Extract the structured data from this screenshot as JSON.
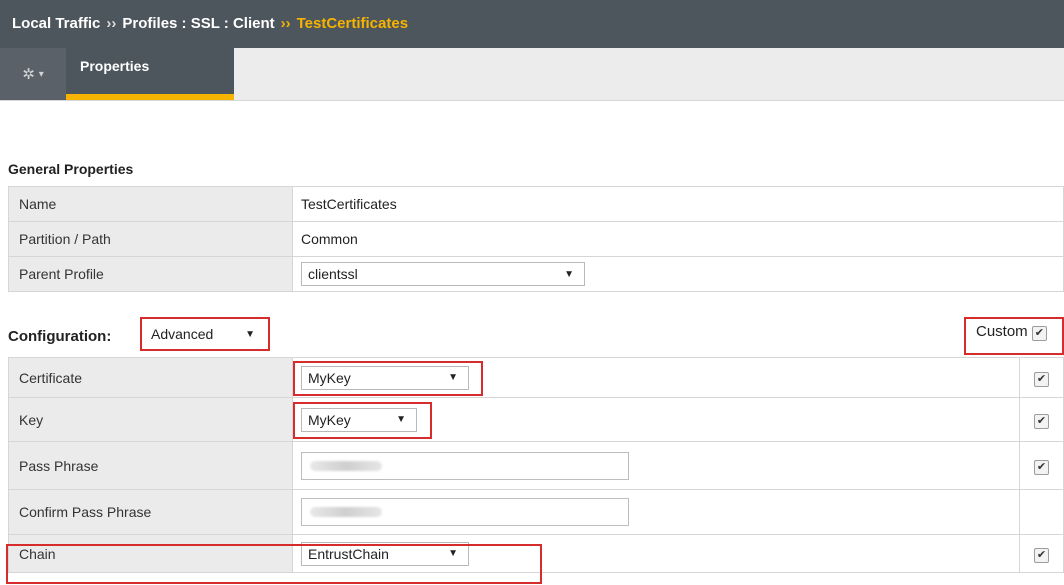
{
  "breadcrumb": {
    "part1": "Local Traffic",
    "sep1": "››",
    "part2": "Profiles : SSL : Client",
    "sep2": "››",
    "current": "TestCertificates"
  },
  "tabs": {
    "gear_icon": "gear-icon",
    "properties_label": "Properties"
  },
  "general": {
    "section_title": "General Properties",
    "rows": {
      "name": {
        "label": "Name",
        "value": "TestCertificates"
      },
      "partition": {
        "label": "Partition / Path",
        "value": "Common"
      },
      "parent": {
        "label": "Parent Profile",
        "value": "clientssl"
      }
    }
  },
  "configuration": {
    "label": "Configuration:",
    "mode_value": "Advanced",
    "custom_label": "Custom",
    "rows": {
      "certificate": {
        "label": "Certificate",
        "value": "MyKey"
      },
      "key": {
        "label": "Key",
        "value": "MyKey"
      },
      "pass_phrase": {
        "label": "Pass Phrase"
      },
      "confirm_pass_phrase": {
        "label": "Confirm Pass Phrase"
      },
      "chain": {
        "label": "Chain",
        "value": "EntrustChain"
      }
    }
  },
  "colors": {
    "header_bg": "#4d555d",
    "accent": "#f6b400",
    "highlight": "#d62c2c"
  }
}
